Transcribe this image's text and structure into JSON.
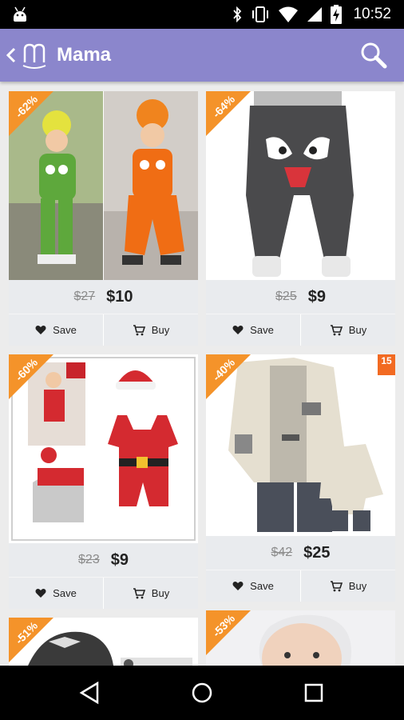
{
  "status_bar": {
    "time": "10:52"
  },
  "app_bar": {
    "title": "Mama"
  },
  "products": [
    {
      "discount": "-62%",
      "old_price": "$27",
      "price": "$10",
      "save_label": "Save",
      "buy_label": "Buy"
    },
    {
      "discount": "-64%",
      "old_price": "$25",
      "price": "$9",
      "save_label": "Save",
      "buy_label": "Buy"
    },
    {
      "discount": "-60%",
      "old_price": "$23",
      "price": "$9",
      "save_label": "Save",
      "buy_label": "Buy"
    },
    {
      "discount": "-40%",
      "badge": "15",
      "old_price": "$42",
      "price": "$25",
      "save_label": "Save",
      "buy_label": "Buy"
    },
    {
      "discount": "-51%"
    },
    {
      "discount": "-53%"
    }
  ],
  "colors": {
    "app_bar": "#8b86cc",
    "discount_ribbon": "#f4932a",
    "badge": "#f26a22",
    "card_footer": "#e9ebee"
  }
}
